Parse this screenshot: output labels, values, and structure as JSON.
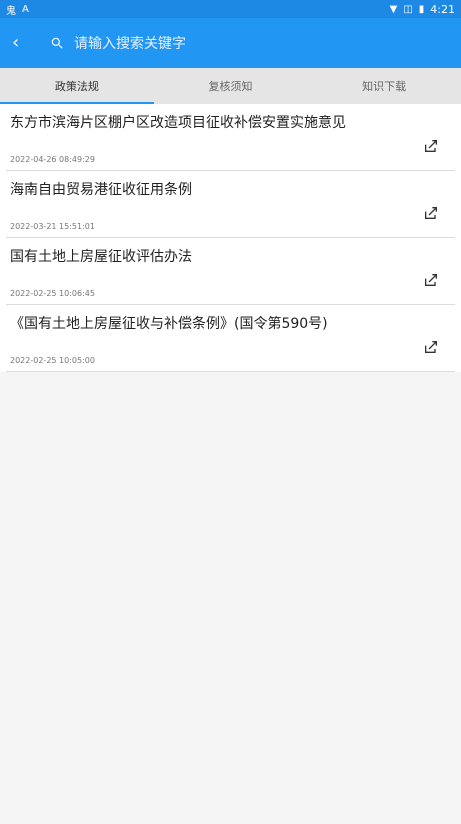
{
  "status": {
    "left_icons": [
      "hook-icon",
      "a-icon"
    ],
    "time": "4:21",
    "right_icons": [
      "wifi-icon",
      "signal-off-icon",
      "battery-icon"
    ]
  },
  "search": {
    "placeholder": "请输入搜索关键字"
  },
  "tabs": [
    {
      "label": "政策法规",
      "active": true
    },
    {
      "label": "复核须知",
      "active": false
    },
    {
      "label": "知识下载",
      "active": false
    }
  ],
  "items": [
    {
      "title": "东方市滨海片区棚户区改造项目征收补偿安置实施意见",
      "time": "2022-04-26 08:49:29"
    },
    {
      "title": "海南自由贸易港征收征用条例",
      "time": "2022-03-21 15:51:01"
    },
    {
      "title": "国有土地上房屋征收评估办法",
      "time": "2022-02-25 10:06:45"
    },
    {
      "title": "《国有土地上房屋征收与补偿条例》(国令第590号)",
      "time": "2022-02-25 10:05:00"
    }
  ]
}
